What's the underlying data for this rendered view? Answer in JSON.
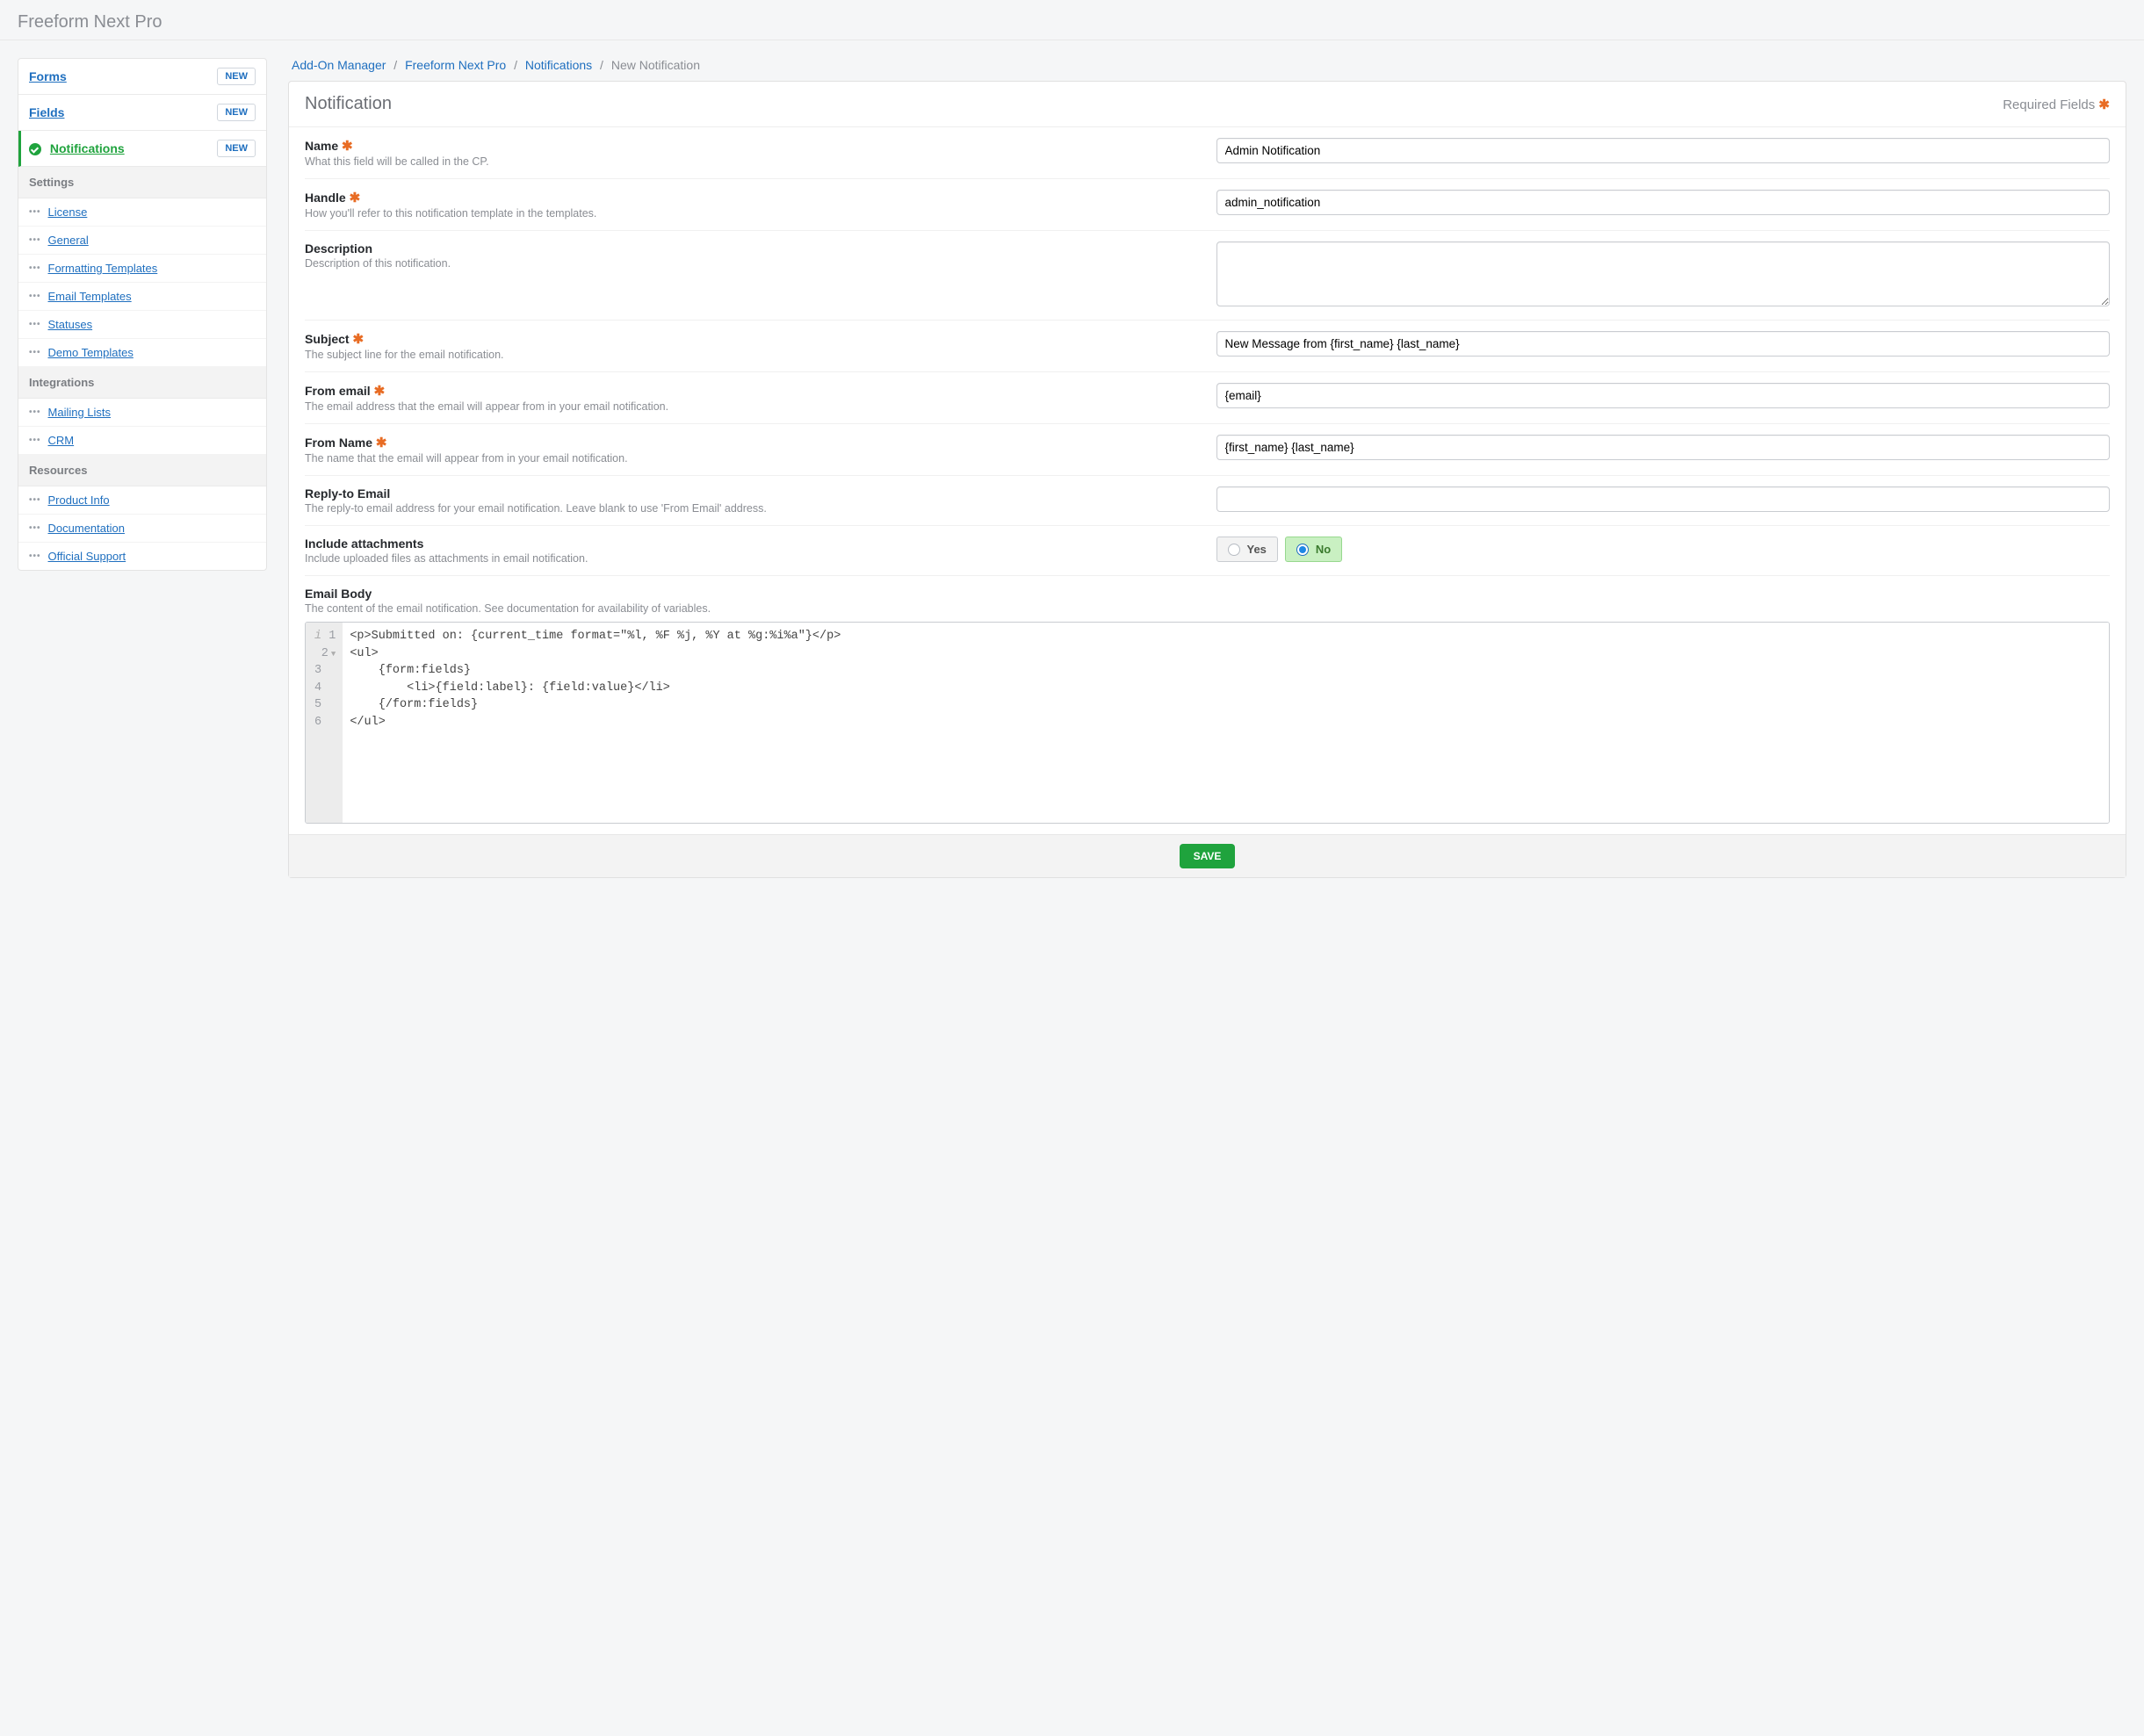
{
  "app_title": "Freeform Next Pro",
  "sidebar": {
    "primary": [
      {
        "label": "Forms",
        "active": false,
        "new_btn": "NEW"
      },
      {
        "label": "Fields",
        "active": false,
        "new_btn": "NEW"
      },
      {
        "label": "Notifications",
        "active": true,
        "new_btn": "NEW"
      }
    ],
    "groups": [
      {
        "header": "Settings",
        "items": [
          {
            "label": "License"
          },
          {
            "label": "General"
          },
          {
            "label": "Formatting Templates"
          },
          {
            "label": "Email Templates"
          },
          {
            "label": "Statuses"
          },
          {
            "label": "Demo Templates"
          }
        ]
      },
      {
        "header": "Integrations",
        "items": [
          {
            "label": "Mailing Lists"
          },
          {
            "label": "CRM"
          }
        ]
      },
      {
        "header": "Resources",
        "items": [
          {
            "label": "Product Info"
          },
          {
            "label": "Documentation"
          },
          {
            "label": "Official Support"
          }
        ]
      }
    ]
  },
  "breadcrumbs": {
    "items": [
      "Add-On Manager",
      "Freeform Next Pro",
      "Notifications"
    ],
    "current": "New Notification",
    "sep": "/"
  },
  "panel": {
    "title": "Notification",
    "required_label": "Required Fields"
  },
  "fields": {
    "name": {
      "label": "Name",
      "required": true,
      "hint": "What this field will be called in the CP.",
      "value": "Admin Notification"
    },
    "handle": {
      "label": "Handle",
      "required": true,
      "hint": "How you'll refer to this notification template in the templates.",
      "value": "admin_notification"
    },
    "description": {
      "label": "Description",
      "required": false,
      "hint": "Description of this notification.",
      "value": ""
    },
    "subject": {
      "label": "Subject",
      "required": true,
      "hint": "The subject line for the email notification.",
      "value": "New Message from {first_name} {last_name}"
    },
    "from_email": {
      "label": "From email",
      "required": true,
      "hint": "The email address that the email will appear from in your email notification.",
      "value": "{email}"
    },
    "from_name": {
      "label": "From Name",
      "required": true,
      "hint": "The name that the email will appear from in your email notification.",
      "value": "{first_name} {last_name}"
    },
    "reply_to": {
      "label": "Reply-to Email",
      "required": false,
      "hint": "The reply-to email address for your email notification. Leave blank to use 'From Email' address.",
      "value": ""
    },
    "attachments": {
      "label": "Include attachments",
      "required": false,
      "hint": "Include uploaded files as attachments in email notification.",
      "yes": "Yes",
      "no": "No",
      "selected": "No"
    },
    "body": {
      "label": "Email Body",
      "required": false,
      "hint": "The content of the email notification. See documentation for availability of variables.",
      "lines": [
        "<p>Submitted on: {current_time format=\"%l, %F %j, %Y at %g:%i%a\"}</p>",
        "<ul>",
        "    {form:fields}",
        "        <li>{field:label}: {field:value}</li>",
        "    {/form:fields}",
        "</ul>"
      ]
    }
  },
  "buttons": {
    "save": "SAVE"
  },
  "asterisk": "✱"
}
